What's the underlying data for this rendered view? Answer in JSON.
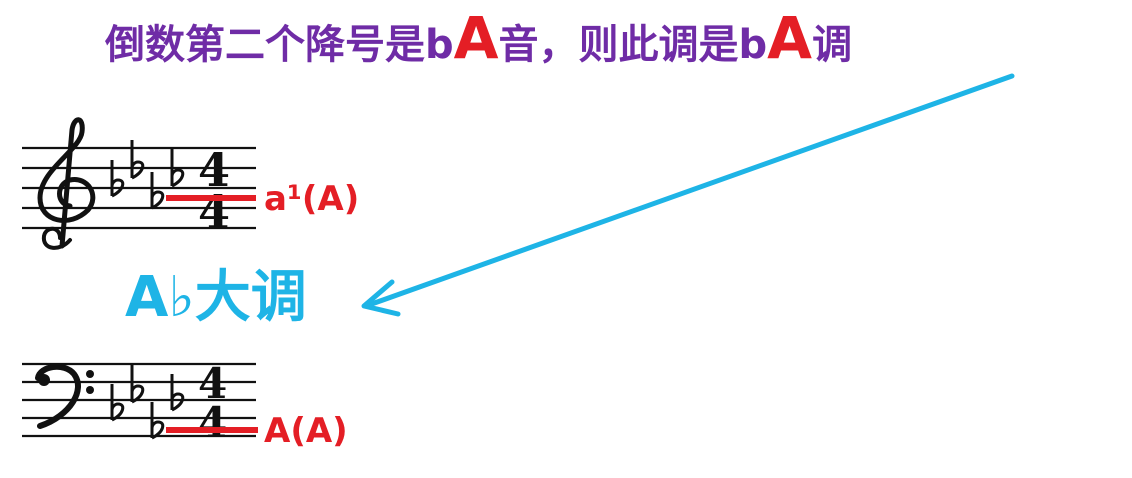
{
  "title": {
    "part1": "倒数第二个降号是b",
    "accent1": "A",
    "part2": "音，则此调是b",
    "accent2": "A",
    "part3": "调"
  },
  "treble_note_label": "a¹(A)",
  "bass_note_label": "A(A)",
  "key_label": "A♭大调",
  "treble_clef": {
    "glyph": "𝄞",
    "flats": "♭ ♭ ♭ ♭",
    "time_top": "4",
    "time_bottom": "4"
  },
  "bass_clef": {
    "glyph": "𝄢",
    "flats": "♭ ♭ ♭ ♭",
    "time_top": "4",
    "time_bottom": "4"
  },
  "colors": {
    "title": "#6f2ca6",
    "accent_red": "#e41e25",
    "arrow_cyan": "#1eb4e6",
    "staff_black": "#111111"
  }
}
